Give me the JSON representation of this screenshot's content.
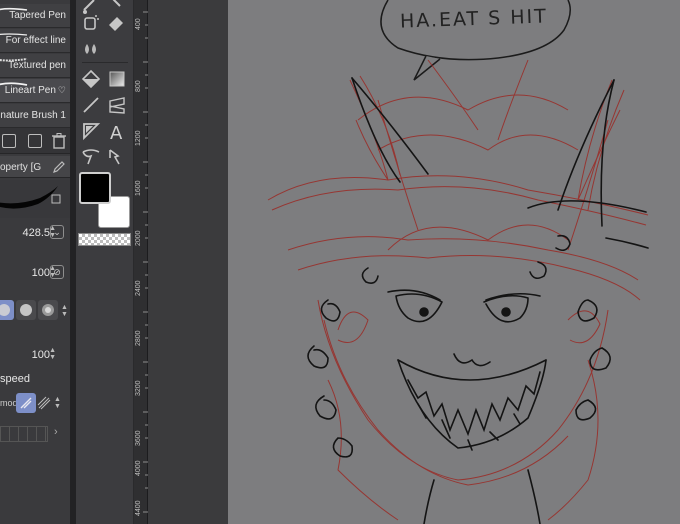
{
  "brushes": [
    {
      "label": "Tapered Pen"
    },
    {
      "label": "For effect line"
    },
    {
      "label": "Textured pen"
    },
    {
      "label": "Lineart Pen",
      "favorite_glyph": "♡"
    },
    {
      "label": "nature Brush 1"
    }
  ],
  "property": {
    "header": "operty [G",
    "brush_size": "428.5",
    "opacity": "100",
    "stabilization": "100",
    "speed_label": "speed",
    "mode_label": "mod"
  },
  "ruler_labels": [
    "400",
    "800",
    "1200",
    "1600",
    "2000",
    "2400",
    "2800",
    "3200",
    "3600",
    "4000",
    "4400"
  ],
  "colors": {
    "main": "#000000",
    "sub": "#ffffff",
    "canvas": "#7d7d7f",
    "sketch": "#9b2a25",
    "lineart": "#141414"
  },
  "canvas": {
    "speech_text": "HA.EAT S HIT"
  }
}
